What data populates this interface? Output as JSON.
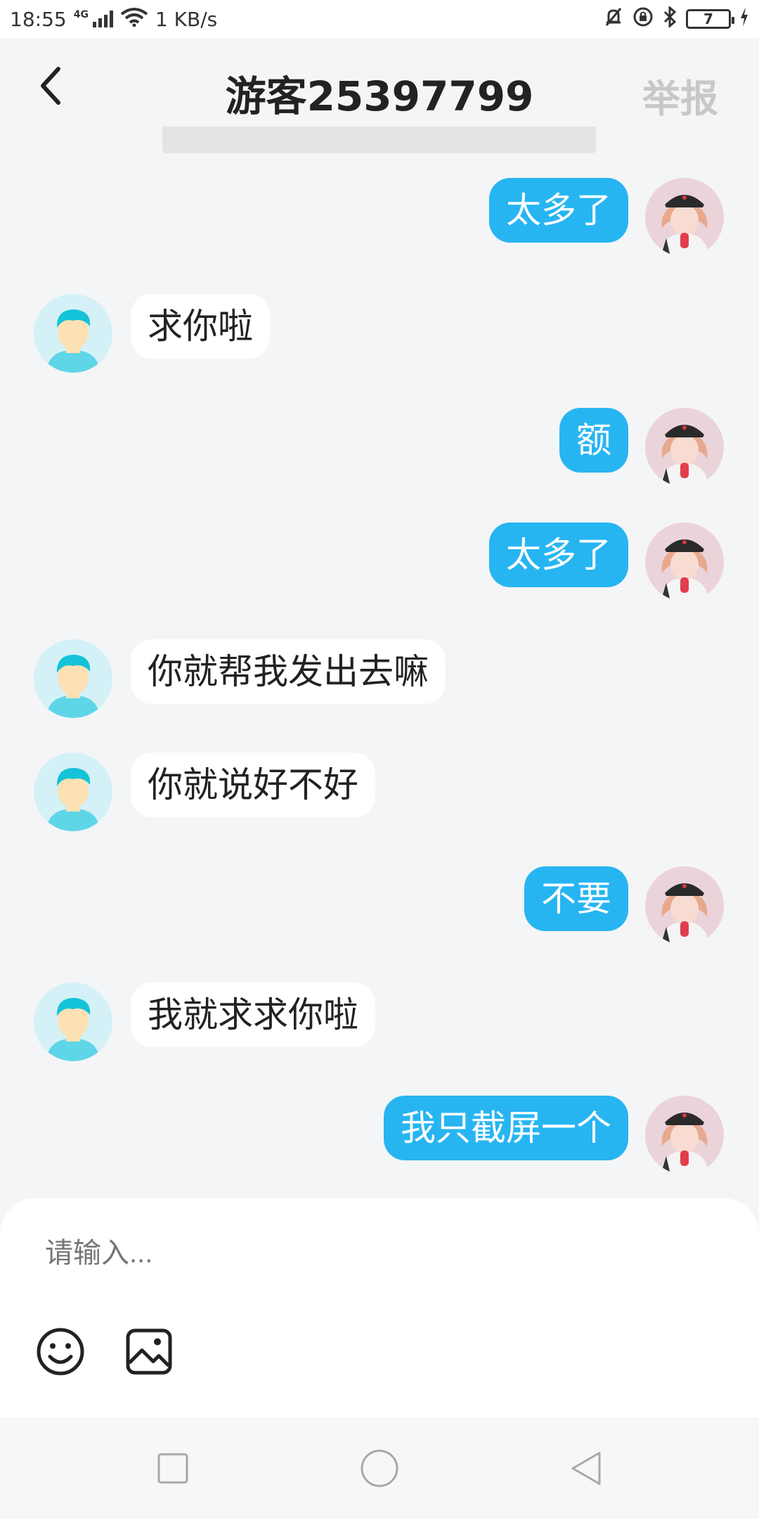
{
  "status_bar": {
    "time": "18:55",
    "network_tag": "4G",
    "speed": "1 KB/s",
    "battery": "7"
  },
  "header": {
    "title": "游客25397799",
    "report_label": "举报"
  },
  "messages": [
    {
      "from": "self",
      "text": "太多了"
    },
    {
      "from": "other",
      "text": "求你啦"
    },
    {
      "from": "self",
      "text": "额"
    },
    {
      "from": "self",
      "text": "太多了"
    },
    {
      "from": "other",
      "text": "你就帮我发出去嘛"
    },
    {
      "from": "other",
      "text": "你就说好不好"
    },
    {
      "from": "self",
      "text": "不要"
    },
    {
      "from": "other",
      "text": "我就求求你啦"
    },
    {
      "from": "self",
      "text": "我只截屏一个"
    }
  ],
  "input": {
    "placeholder": "请输入..."
  },
  "colors": {
    "accent": "#27b5f2",
    "background": "#f4f5f7"
  },
  "icons": {
    "emoji": "emoji-icon",
    "image": "image-icon",
    "back": "back-arrow-icon"
  }
}
